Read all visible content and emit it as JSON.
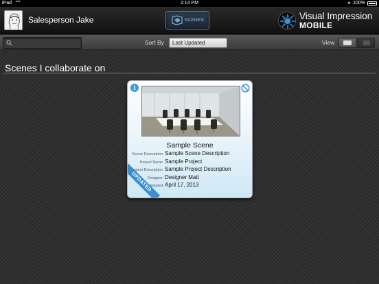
{
  "status_bar": {
    "device": "iPad",
    "time": "2:14 PM",
    "battery": "100%"
  },
  "header": {
    "user_name": "Salesperson Jake",
    "scenes_button_label": "SCENES",
    "brand_title": "Visual Impression",
    "brand_subtitle": "MOBILE"
  },
  "toolbar": {
    "search_value": "",
    "sort_label": "Sort By",
    "sort_selected": "Last Updated",
    "view_label": "View"
  },
  "section": {
    "title": "Scenes I collaborate on"
  },
  "scene_card": {
    "title": "Sample Scene",
    "ribbon": "UPDATED",
    "fields": [
      {
        "label": "Scene Description",
        "value": "Sample Scene Description"
      },
      {
        "label": "Project Name",
        "value": "Sample Project"
      },
      {
        "label": "Project Description",
        "value": "Sample Project Description"
      },
      {
        "label": "Designer",
        "value": "Designer Matt"
      },
      {
        "label": "Updated",
        "value": "April 17, 2013"
      }
    ]
  },
  "colors": {
    "accent_blue": "#3a8fd0",
    "background": "#2f2f2f",
    "card_gradient_end": "#cfe8f6"
  },
  "icons": [
    "search-icon",
    "info-icon",
    "no-access-icon",
    "scenes-icon",
    "brand-logo-icon",
    "wifi-icon",
    "battery-icon",
    "location-icon"
  ]
}
